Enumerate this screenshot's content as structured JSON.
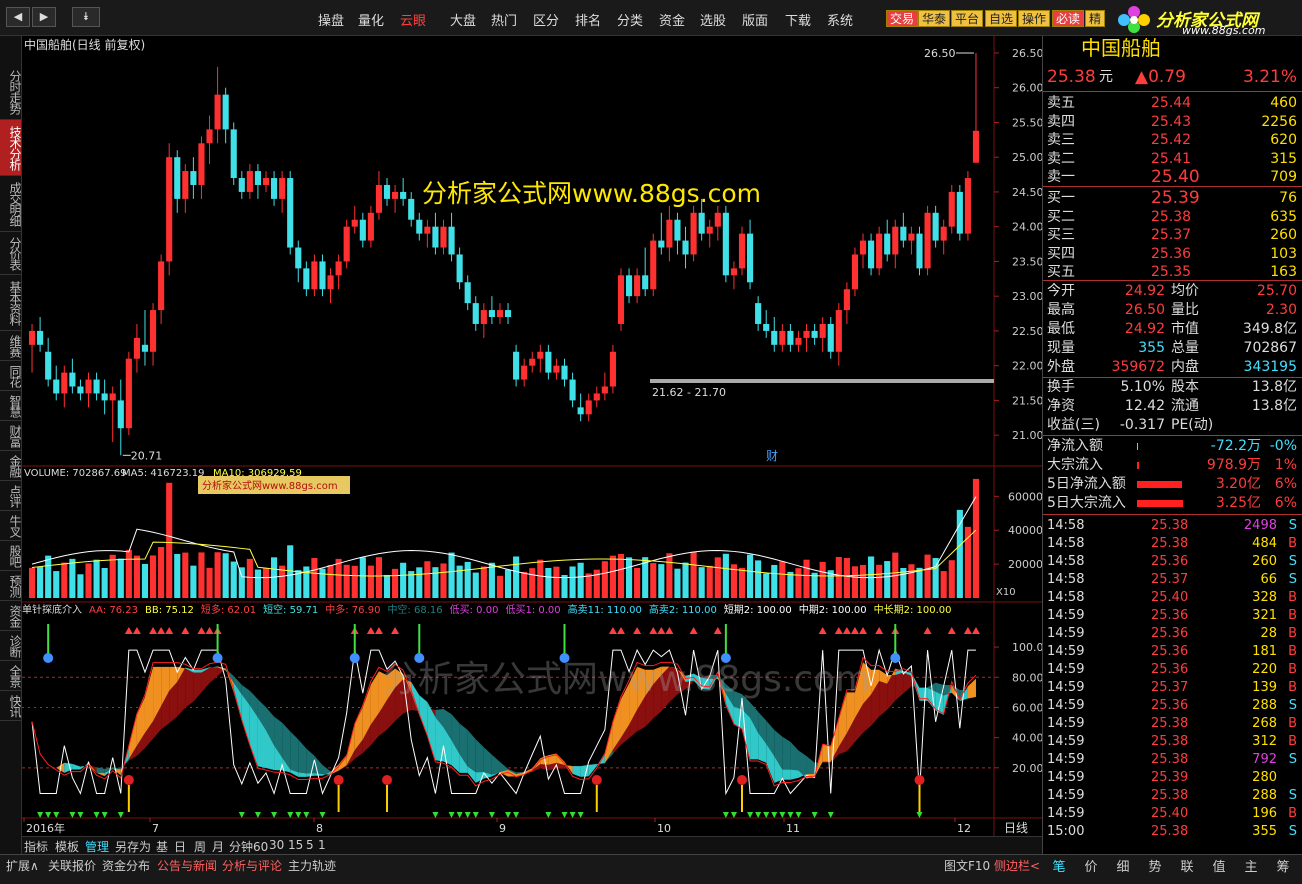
{
  "toolbar": {
    "nav": [
      "◀",
      "▶",
      "⯯"
    ],
    "menu": [
      "操盘",
      "量化",
      "云眼",
      "大盘",
      "热门",
      "区分",
      "排名",
      "分类",
      "资金",
      "选股",
      "版面",
      "下载",
      "系统"
    ],
    "active_menu": 2,
    "tags": [
      "交易",
      "华泰",
      "平台",
      "自选",
      "操作",
      "必读",
      "精"
    ],
    "logo_text": "分析家公式网",
    "logo_url": "www.88gs.com"
  },
  "left_tabs": [
    "分时走势",
    "技术分析",
    "成交明细",
    "分价表",
    "基本资料",
    "维赛",
    "同花",
    "智慧",
    "财富",
    "金融",
    "点评",
    "牛叉",
    "股吧",
    "预测",
    "资金",
    "诊断",
    "全景",
    "快讯"
  ],
  "active_left_tab": 1,
  "chart": {
    "title": "中国船舶(日线 前复权)",
    "watermark": "分析家公式网www.88gs.com",
    "watermark2": "分析家公式网www.88gs.com",
    "watermark_small": "分析家公式网www.88gs.com",
    "price_axis": [
      "26.50",
      "26.00",
      "25.50",
      "25.00",
      "24.50",
      "24.00",
      "23.50",
      "23.00",
      "22.50",
      "22.00",
      "21.50",
      "21.00"
    ],
    "high_label": "26.50",
    "low_label": "20.71",
    "range_label": "21.62 - 21.70",
    "cai_label": "财",
    "volume_legend": {
      "v": "VOLUME: 702867.69",
      "ma5": "MA5: 416723.19",
      "ma10": "MA10: 306929.59"
    },
    "volume_axis": [
      "60000",
      "40000",
      "20000"
    ],
    "volume_unit": "X10",
    "indicator_legend": [
      {
        "text": "单针探底介入",
        "color": "#dddddd"
      },
      {
        "text": "AA: 76.23",
        "color": "#ff4040"
      },
      {
        "text": "BB: 75.12",
        "color": "#ffff40"
      },
      {
        "text": "短多: 62.01",
        "color": "#ff4040"
      },
      {
        "text": "短空: 59.71",
        "color": "#40e0e0"
      },
      {
        "text": "中多: 76.90",
        "color": "#ff4040"
      },
      {
        "text": "中空: 68.16",
        "color": "#208080"
      },
      {
        "text": "低买: 0.00",
        "color": "#e040e0"
      },
      {
        "text": "低买1: 0.00",
        "color": "#e040e0"
      },
      {
        "text": "高卖11: 110.00",
        "color": "#40e0ff"
      },
      {
        "text": "高卖2: 110.00",
        "color": "#40e0ff"
      },
      {
        "text": "短期2: 100.00",
        "color": "#ffffff"
      },
      {
        "text": "中期2: 100.00",
        "color": "#ffffff"
      },
      {
        "text": "中长期2: 100.00",
        "color": "#ffff40"
      }
    ],
    "indicator_axis": [
      "100.0",
      "80.00",
      "60.00",
      "40.00",
      "20.00"
    ],
    "date_labels": [
      "2016年",
      "7",
      "8",
      "9",
      "10",
      "11",
      "12"
    ],
    "period_label": "日线"
  },
  "bottom_bar": [
    "指标",
    "模板",
    "管理",
    "另存为",
    "基",
    "日",
    "周",
    "月",
    "分钟60",
    "30",
    "15",
    "5",
    "1"
  ],
  "status_bar": [
    "扩展∧",
    "关联报价",
    "资金分布",
    "公告与新闻",
    "分析与评论",
    "主力轨迹"
  ],
  "status_right": "图文F10",
  "status_side": "侧边栏<",
  "right_tabs": [
    "笔",
    "价",
    "细",
    "势",
    "联",
    "值",
    "主",
    "筹"
  ],
  "quote": {
    "name": "中国船舶",
    "price": "25.38",
    "unit": "元",
    "change": "▲0.79",
    "pct": "3.21%",
    "asks": [
      {
        "label": "卖五",
        "price": "25.44",
        "vol": "460"
      },
      {
        "label": "卖四",
        "price": "25.43",
        "vol": "2256"
      },
      {
        "label": "卖三",
        "price": "25.42",
        "vol": "620"
      },
      {
        "label": "卖二",
        "price": "25.41",
        "vol": "315"
      },
      {
        "label": "卖一",
        "price": "25.40",
        "vol": "709"
      }
    ],
    "bids": [
      {
        "label": "买一",
        "price": "25.39",
        "vol": "76"
      },
      {
        "label": "买二",
        "price": "25.38",
        "vol": "635"
      },
      {
        "label": "买三",
        "price": "25.37",
        "vol": "260"
      },
      {
        "label": "买四",
        "price": "25.36",
        "vol": "103"
      },
      {
        "label": "买五",
        "price": "25.35",
        "vol": "163"
      }
    ],
    "stats": [
      {
        "l1": "今开",
        "v1": "24.92",
        "c1": "cr",
        "l2": "均价",
        "v2": "25.70",
        "c2": "cr"
      },
      {
        "l1": "最高",
        "v1": "26.50",
        "c1": "cr",
        "l2": "量比",
        "v2": "2.30",
        "c2": "cr"
      },
      {
        "l1": "最低",
        "v1": "24.92",
        "c1": "cr",
        "l2": "市值",
        "v2": "349.8亿",
        "c2": "cw"
      },
      {
        "l1": "现量",
        "v1": "355",
        "c1": "cc",
        "l2": "总量",
        "v2": "702867",
        "c2": "cw"
      },
      {
        "l1": "外盘",
        "v1": "359672",
        "c1": "cr",
        "l2": "内盘",
        "v2": "343195",
        "c2": "cc"
      }
    ],
    "stats2": [
      {
        "l1": "换手",
        "v1": "5.10%",
        "l2": "股本",
        "v2": "13.8亿"
      },
      {
        "l1": "净资",
        "v1": "12.42",
        "l2": "流通",
        "v2": "13.8亿"
      },
      {
        "l1": "收益(三)",
        "v1": "-0.317",
        "l2": "PE(动)",
        "v2": ""
      }
    ],
    "flows": [
      {
        "label": "净流入额",
        "val": "-72.2万",
        "pct": "-0%",
        "color": "cc",
        "bar": 0.02
      },
      {
        "label": "大宗流入",
        "val": "978.9万",
        "pct": "1%",
        "color": "cr",
        "bar": 0.04
      },
      {
        "label": "5日净流入额",
        "val": "3.20亿",
        "pct": "6%",
        "color": "cr",
        "bar": 0.9
      },
      {
        "label": "5日大宗流入",
        "val": "3.25亿",
        "pct": "6%",
        "color": "cr",
        "bar": 0.92
      }
    ],
    "ticks": [
      {
        "t": "14:58",
        "p": "25.38",
        "v": "2498",
        "s": "S",
        "vc": "cm"
      },
      {
        "t": "14:58",
        "p": "25.38",
        "v": "484",
        "s": "B",
        "vc": "cy"
      },
      {
        "t": "14:58",
        "p": "25.36",
        "v": "260",
        "s": "S",
        "vc": "cy"
      },
      {
        "t": "14:58",
        "p": "25.37",
        "v": "66",
        "s": "S",
        "vc": "cy"
      },
      {
        "t": "14:58",
        "p": "25.40",
        "v": "328",
        "s": "B",
        "vc": "cy"
      },
      {
        "t": "14:59",
        "p": "25.36",
        "v": "321",
        "s": "B",
        "vc": "cy"
      },
      {
        "t": "14:59",
        "p": "25.36",
        "v": "28",
        "s": "B",
        "vc": "cy"
      },
      {
        "t": "14:59",
        "p": "25.36",
        "v": "181",
        "s": "B",
        "vc": "cy"
      },
      {
        "t": "14:59",
        "p": "25.36",
        "v": "220",
        "s": "B",
        "vc": "cy"
      },
      {
        "t": "14:59",
        "p": "25.37",
        "v": "139",
        "s": "B",
        "vc": "cy"
      },
      {
        "t": "14:59",
        "p": "25.36",
        "v": "288",
        "s": "S",
        "vc": "cy"
      },
      {
        "t": "14:59",
        "p": "25.38",
        "v": "268",
        "s": "B",
        "vc": "cy"
      },
      {
        "t": "14:59",
        "p": "25.38",
        "v": "312",
        "s": "B",
        "vc": "cy"
      },
      {
        "t": "14:59",
        "p": "25.38",
        "v": "792",
        "s": "S",
        "vc": "cm"
      },
      {
        "t": "14:59",
        "p": "25.39",
        "v": "280",
        "s": "",
        "vc": "cy"
      },
      {
        "t": "14:59",
        "p": "25.38",
        "v": "288",
        "s": "S",
        "vc": "cy"
      },
      {
        "t": "14:59",
        "p": "25.40",
        "v": "196",
        "s": "B",
        "vc": "cy"
      },
      {
        "t": "15:00",
        "p": "25.38",
        "v": "355",
        "s": "S",
        "vc": "cy"
      }
    ]
  },
  "chart_data": {
    "type": "candlestick",
    "ylim": [
      20.7,
      26.6
    ],
    "ohlc": [
      [
        22.3,
        22.6,
        21.9,
        22.5
      ],
      [
        22.5,
        22.7,
        22.2,
        22.3
      ],
      [
        22.2,
        22.4,
        21.7,
        21.8
      ],
      [
        21.8,
        22.0,
        21.5,
        21.6
      ],
      [
        21.6,
        22.0,
        21.4,
        21.9
      ],
      [
        21.9,
        22.1,
        21.6,
        21.7
      ],
      [
        21.7,
        21.8,
        21.5,
        21.6
      ],
      [
        21.6,
        21.9,
        21.4,
        21.8
      ],
      [
        21.8,
        21.9,
        21.5,
        21.6
      ],
      [
        21.6,
        21.8,
        21.3,
        21.5
      ],
      [
        21.5,
        21.7,
        20.9,
        21.6
      ],
      [
        21.5,
        21.8,
        20.71,
        21.1
      ],
      [
        21.1,
        22.2,
        21.0,
        22.1
      ],
      [
        22.1,
        22.6,
        21.9,
        22.4
      ],
      [
        22.3,
        22.8,
        22.0,
        22.2
      ],
      [
        22.2,
        22.9,
        22.0,
        22.8
      ],
      [
        22.8,
        23.6,
        22.6,
        23.5
      ],
      [
        23.5,
        25.2,
        23.3,
        25.0
      ],
      [
        25.0,
        25.1,
        24.2,
        24.4
      ],
      [
        24.4,
        24.9,
        24.2,
        24.8
      ],
      [
        24.8,
        25.0,
        24.4,
        24.6
      ],
      [
        24.6,
        25.3,
        24.4,
        25.2
      ],
      [
        25.2,
        25.6,
        24.9,
        25.4
      ],
      [
        25.4,
        26.3,
        25.2,
        25.9
      ],
      [
        25.9,
        26.0,
        25.2,
        25.4
      ],
      [
        25.4,
        25.5,
        24.6,
        24.7
      ],
      [
        24.7,
        24.8,
        24.4,
        24.5
      ],
      [
        24.5,
        24.9,
        24.4,
        24.8
      ],
      [
        24.8,
        24.9,
        24.4,
        24.6
      ],
      [
        24.6,
        24.8,
        24.5,
        24.7
      ],
      [
        24.7,
        24.8,
        24.3,
        24.4
      ],
      [
        24.4,
        24.8,
        24.2,
        24.7
      ],
      [
        24.7,
        24.8,
        23.6,
        23.7
      ],
      [
        23.7,
        23.8,
        23.2,
        23.4
      ],
      [
        23.4,
        23.5,
        23.0,
        23.1
      ],
      [
        23.1,
        23.6,
        23.0,
        23.5
      ],
      [
        23.5,
        23.6,
        23.0,
        23.1
      ],
      [
        23.1,
        23.4,
        22.9,
        23.3
      ],
      [
        23.3,
        23.6,
        23.1,
        23.5
      ],
      [
        23.5,
        24.1,
        23.4,
        24.0
      ],
      [
        24.0,
        24.3,
        23.9,
        24.1
      ],
      [
        24.1,
        24.2,
        23.7,
        23.8
      ],
      [
        23.8,
        24.3,
        23.7,
        24.2
      ],
      [
        24.2,
        24.8,
        24.1,
        24.6
      ],
      [
        24.6,
        24.7,
        24.3,
        24.4
      ],
      [
        24.4,
        24.6,
        24.2,
        24.5
      ],
      [
        24.5,
        24.7,
        24.3,
        24.4
      ],
      [
        24.4,
        24.5,
        24.0,
        24.1
      ],
      [
        24.1,
        24.2,
        23.8,
        23.9
      ],
      [
        23.9,
        24.1,
        23.7,
        24.0
      ],
      [
        24.0,
        24.2,
        23.6,
        23.7
      ],
      [
        23.7,
        24.1,
        23.6,
        24.0
      ],
      [
        24.0,
        24.2,
        23.5,
        23.6
      ],
      [
        23.6,
        23.7,
        23.1,
        23.2
      ],
      [
        23.2,
        23.3,
        22.8,
        22.9
      ],
      [
        22.9,
        23.0,
        22.5,
        22.6
      ],
      [
        22.6,
        22.9,
        22.4,
        22.8
      ],
      [
        22.8,
        23.0,
        22.6,
        22.7
      ],
      [
        22.7,
        22.9,
        22.6,
        22.8
      ],
      [
        22.8,
        22.9,
        22.6,
        22.7
      ],
      [
        22.2,
        22.3,
        21.7,
        21.8
      ],
      [
        21.8,
        22.1,
        21.7,
        22.0
      ],
      [
        22.0,
        22.2,
        21.9,
        22.1
      ],
      [
        22.1,
        22.3,
        21.9,
        22.2
      ],
      [
        22.2,
        22.3,
        21.8,
        21.9
      ],
      [
        21.9,
        22.1,
        21.8,
        22.0
      ],
      [
        22.0,
        22.1,
        21.7,
        21.8
      ],
      [
        21.8,
        21.9,
        21.4,
        21.5
      ],
      [
        21.4,
        21.6,
        21.2,
        21.3
      ],
      [
        21.3,
        21.6,
        21.2,
        21.5
      ],
      [
        21.5,
        21.7,
        21.4,
        21.6
      ],
      [
        21.6,
        21.9,
        21.5,
        21.7
      ],
      [
        21.7,
        22.3,
        21.6,
        22.2
      ],
      [
        22.6,
        23.4,
        22.5,
        23.3
      ],
      [
        23.3,
        23.4,
        22.9,
        23.0
      ],
      [
        23.0,
        23.4,
        22.9,
        23.3
      ],
      [
        23.3,
        23.7,
        23.0,
        23.1
      ],
      [
        23.1,
        23.9,
        23.0,
        23.8
      ],
      [
        23.8,
        24.2,
        23.6,
        23.7
      ],
      [
        23.7,
        24.3,
        23.5,
        24.1
      ],
      [
        24.1,
        24.2,
        23.6,
        23.8
      ],
      [
        23.8,
        24.0,
        23.4,
        23.6
      ],
      [
        23.6,
        24.3,
        23.5,
        24.2
      ],
      [
        24.2,
        24.4,
        23.8,
        23.9
      ],
      [
        23.9,
        24.1,
        23.7,
        24.0
      ],
      [
        24.0,
        24.3,
        23.8,
        24.2
      ],
      [
        24.2,
        24.3,
        23.2,
        23.3
      ],
      [
        23.3,
        23.5,
        23.1,
        23.4
      ],
      [
        23.4,
        24.0,
        23.3,
        23.9
      ],
      [
        23.9,
        24.1,
        23.1,
        23.2
      ],
      [
        22.9,
        23.0,
        22.5,
        22.6
      ],
      [
        22.6,
        22.8,
        22.4,
        22.5
      ],
      [
        22.5,
        22.7,
        22.2,
        22.3
      ],
      [
        22.3,
        22.6,
        22.2,
        22.5
      ],
      [
        22.5,
        22.6,
        22.2,
        22.3
      ],
      [
        22.3,
        22.5,
        22.2,
        22.4
      ],
      [
        22.4,
        22.6,
        22.2,
        22.5
      ],
      [
        22.5,
        22.6,
        22.3,
        22.4
      ],
      [
        22.4,
        22.7,
        22.2,
        22.6
      ],
      [
        22.6,
        22.7,
        22.1,
        22.2
      ],
      [
        22.2,
        22.9,
        22.0,
        22.8
      ],
      [
        22.8,
        23.2,
        22.6,
        23.1
      ],
      [
        23.1,
        23.7,
        23.0,
        23.6
      ],
      [
        23.6,
        23.9,
        23.4,
        23.8
      ],
      [
        23.8,
        23.9,
        23.3,
        23.4
      ],
      [
        23.4,
        24.0,
        23.3,
        23.9
      ],
      [
        23.9,
        24.1,
        23.5,
        23.6
      ],
      [
        23.6,
        24.1,
        23.4,
        24.0
      ],
      [
        24.0,
        24.2,
        23.7,
        23.8
      ],
      [
        23.8,
        24.0,
        23.6,
        23.9
      ],
      [
        23.9,
        24.0,
        23.3,
        23.4
      ],
      [
        23.4,
        24.3,
        23.3,
        24.2
      ],
      [
        24.2,
        24.3,
        23.7,
        23.8
      ],
      [
        23.8,
        24.1,
        23.6,
        24.0
      ],
      [
        24.0,
        24.6,
        23.9,
        24.5
      ],
      [
        24.5,
        24.6,
        23.8,
        23.9
      ],
      [
        23.9,
        24.8,
        23.8,
        24.7
      ],
      [
        24.92,
        26.5,
        24.92,
        25.38
      ]
    ]
  }
}
